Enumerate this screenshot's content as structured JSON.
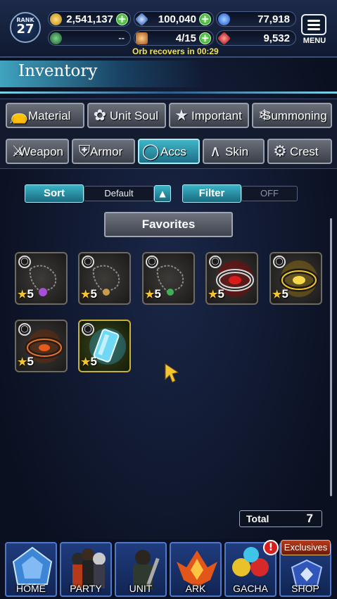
{
  "status": {
    "rank_label": "RANK",
    "rank": "27",
    "gil": "2,541,137",
    "lapis": "100,040",
    "blue_orbs": "77,918",
    "stamina": "--",
    "arena_orbs": "4/15",
    "red_orbs": "9,532",
    "orb_timer": "Orb recovers in 00:29",
    "menu_label": "MENU"
  },
  "header": {
    "title": "Inventory"
  },
  "tabs_row1": [
    {
      "label": "Material",
      "icon": "bag-icon"
    },
    {
      "label": "Unit Soul",
      "icon": "soul-icon"
    },
    {
      "label": "Important",
      "icon": "star-icon"
    },
    {
      "label": "Summoning",
      "icon": "summon-icon"
    }
  ],
  "tabs_row2": [
    {
      "label": "Weapon",
      "icon": "sword-icon"
    },
    {
      "label": "Armor",
      "icon": "armor-icon"
    },
    {
      "label": "Accs",
      "icon": "necklace-icon",
      "active": true
    },
    {
      "label": "Skin",
      "icon": "hanger-icon"
    },
    {
      "label": "Crest",
      "icon": "crest-icon"
    }
  ],
  "controls": {
    "sort_label": "Sort",
    "sort_value": "Default",
    "filter_label": "Filter",
    "filter_value": "OFF",
    "favorites_label": "Favorites"
  },
  "items": [
    {
      "rarity": "5",
      "kind": "pendant-purple"
    },
    {
      "rarity": "5",
      "kind": "pendant-amber"
    },
    {
      "rarity": "5",
      "kind": "pendant-green"
    },
    {
      "rarity": "5",
      "kind": "ring-red"
    },
    {
      "rarity": "5",
      "kind": "ring-gold"
    },
    {
      "rarity": "5",
      "kind": "ring-flame"
    },
    {
      "rarity": "5",
      "kind": "crystal-vial"
    }
  ],
  "total": {
    "label": "Total",
    "count": "7"
  },
  "nav": [
    {
      "label": "HOME"
    },
    {
      "label": "PARTY"
    },
    {
      "label": "UNIT"
    },
    {
      "label": "ARK"
    },
    {
      "label": "GACHA"
    },
    {
      "label": "SHOP"
    }
  ],
  "badges": {
    "exclusives": "Exclusives",
    "alert": "!"
  },
  "colors": {
    "accent": "#3ab4c6",
    "star": "#f3c534",
    "timer": "#f5e14a"
  }
}
